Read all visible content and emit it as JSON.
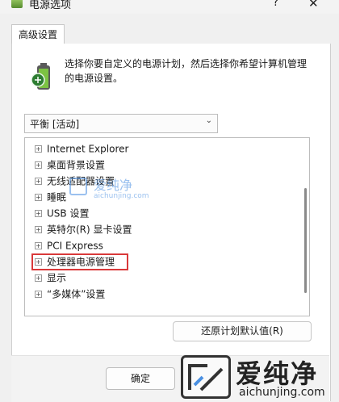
{
  "window": {
    "title": "电源选项",
    "help_glyph": "?",
    "close_glyph": "✕"
  },
  "tabs": [
    {
      "label": "高级设置"
    }
  ],
  "description": "选择你要自定义的电源计划，然后选择你希望计算机管理的电源设置。",
  "plan_select": {
    "value": "平衡 [活动]"
  },
  "tree": {
    "items": [
      {
        "label": "Internet Explorer"
      },
      {
        "label": "桌面背景设置"
      },
      {
        "label": "无线适配器设置"
      },
      {
        "label": "睡眠"
      },
      {
        "label": "USB 设置"
      },
      {
        "label": "英特尔(R) 显卡设置"
      },
      {
        "label": "PCI Express"
      },
      {
        "label": "处理器电源管理"
      },
      {
        "label": "显示"
      },
      {
        "label": "“多媒体”设置"
      }
    ],
    "expander_glyph": "+"
  },
  "buttons": {
    "restore": "还原计划默认值(R)",
    "ok": "确定"
  },
  "watermark": {
    "brand": "爱纯净",
    "url": "aichunjing.com"
  },
  "colors": {
    "highlight": "#d9393a",
    "watermark_blue": "#4a90e2"
  }
}
